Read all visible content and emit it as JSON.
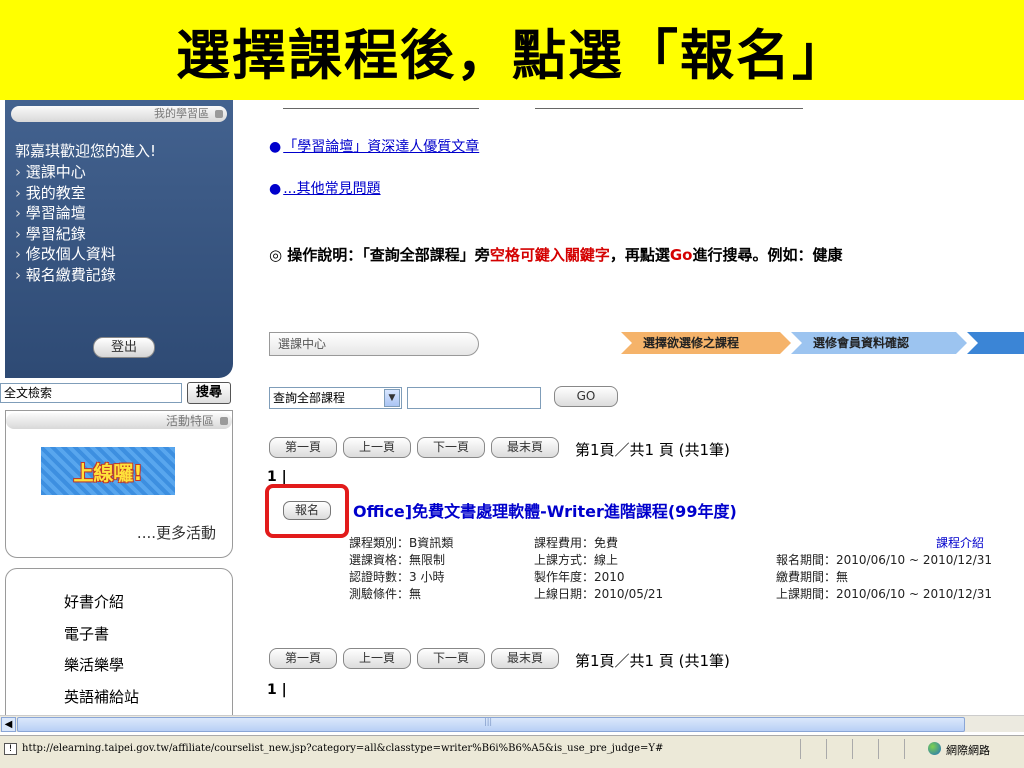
{
  "banner": {
    "title": "選擇課程後，點選「報名」"
  },
  "sidebar": {
    "member_header": "我的學習區",
    "welcome": "郭嘉琪歡迎您的進入!",
    "menu": [
      "選課中心",
      "我的教室",
      "學習論壇",
      "學習紀錄",
      "修改個人資料",
      "報名繳費記錄"
    ],
    "logout": "登出",
    "search_label": "全文檢索",
    "search_button": "搜尋",
    "activity_header": "活動特區",
    "online_badge": "上線囉!",
    "more_activity": "....更多活動",
    "links": [
      "好書介紹",
      "電子書",
      "樂活樂學",
      "英語補給站"
    ]
  },
  "main": {
    "link1": "「學習論壇」資深達人優質文章",
    "link2": "...其他常見問題",
    "instructions": {
      "prefix": "◎ 操作說明：「查詢全部課程」旁",
      "red1": "空格可鍵入關鍵字",
      "mid": "，再點選",
      "red2": "Go",
      "suffix": "進行搜尋。例如：健康"
    },
    "course_center_tab": "選課中心",
    "steps": [
      "選擇欲選修之課程",
      "選修會員資料確認",
      ""
    ],
    "course_select": "查詢全部課程",
    "keyword_value": "",
    "go_button": "GO",
    "pager": {
      "first": "第一頁",
      "prev": "上一頁",
      "next": "下一頁",
      "last": "最末頁",
      "info": "第1頁／共1 頁 (共1筆)",
      "page_num": "1 |"
    },
    "course": {
      "register_button": "報名",
      "title": "Office]免費文書處理軟體-Writer進階課程(99年度)",
      "intro_link": "課程介紹",
      "col1": [
        "課程類別：B資訊類",
        "選課資格：無限制",
        "認證時數：3 小時",
        "測驗條件：無"
      ],
      "col2": [
        "課程費用：免費",
        "上課方式：線上",
        "製作年度：2010",
        "上線日期：2010/05/21"
      ],
      "col3": [
        "",
        "報名期間：2010/06/10 ~ 2010/12/31",
        "繳費期間：無",
        "上課期間：2010/06/10 ~ 2010/12/31"
      ]
    }
  },
  "statusbar": {
    "url": "http://elearning.taipei.gov.tw/affiliate/courselist_new.jsp?category=all&classtype=writer%B6i%B6%A5&is_use_pre_judge=Y#",
    "zone": "網際網路"
  },
  "colors": {
    "banner": "#ffff00",
    "sidebar": "#3a5785",
    "highlight": "#e21b1b",
    "link": "#0000cc"
  }
}
